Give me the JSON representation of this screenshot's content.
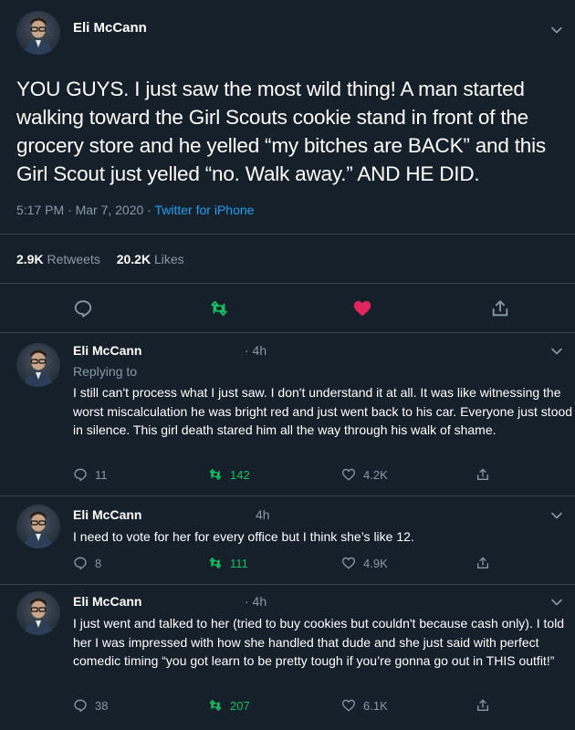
{
  "main_tweet": {
    "author": "Eli McCann",
    "text": "YOU GUYS. I just saw the most wild thing! A man started walking toward the Girl Scouts cookie stand in front of the grocery store and he yelled “my bitches are BACK” and this Girl Scout just yelled “no. Walk away.” AND HE DID.",
    "time": "5:17 PM · Mar 7, 2020 · ",
    "source": "Twitter for iPhone",
    "retweets_count": "2.9K",
    "retweets_label": "Retweets",
    "likes_count": "20.2K",
    "likes_label": "Likes"
  },
  "replies": [
    {
      "author": "Eli McCann",
      "time": "· 4h",
      "replying_to": "Replying to",
      "text": "I still can't process what I just saw. I don't understand it at all. It was like witnessing the worst miscalculation he was bright red and just went back to his car. Everyone just stood in silence. This girl death stared him all the way through his walk of shame.",
      "replies": "11",
      "retweets": "142",
      "likes": "4.2K"
    },
    {
      "author": "Eli McCann",
      "time": "4h",
      "text": "I need to vote for her for every office but I think she’s like 12.",
      "replies": "8",
      "retweets": "111",
      "likes": "4.9K"
    },
    {
      "author": "Eli McCann",
      "time": "· 4h",
      "text": "I just went and talked to her (tried to buy cookies but couldn't because cash only). I told her I was impressed with how she handled that dude and she just said with perfect comedic timing “you got learn to be pretty tough if you’re gonna go out in THIS outfit!”",
      "replies": "38",
      "retweets": "207",
      "likes": "6.1K"
    }
  ],
  "colors": {
    "background": "#15202b",
    "muted": "#8899a6",
    "link": "#1da1f2",
    "retweet": "#17bf63",
    "like": "#e0245e"
  }
}
